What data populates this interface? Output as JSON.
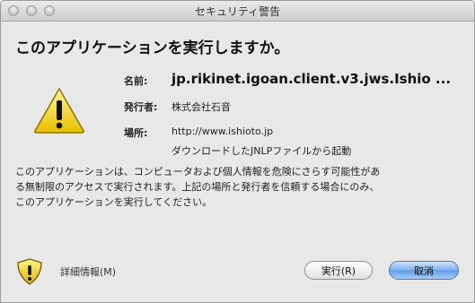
{
  "window": {
    "title": "セキュリティ警告"
  },
  "dialog": {
    "headline": "このアプリケーションを実行しますか。",
    "fields": {
      "name_label": "名前:",
      "name_value": "jp.rikinet.igoan.client.v3.jws.Ishio ...",
      "publisher_label": "発行者:",
      "publisher_value": "株式会社石音",
      "location_label": "場所:",
      "location_url": "http://www.ishioto.jp",
      "location_sub": "ダウンロードしたJNLPファイルから起動"
    },
    "description_lines": [
      "このアプリケーションは、コンピュータおよび個人情報を危険にさらす可能性があ",
      "る無制限のアクセスで実行されます。上記の場所と発行者を信頼する場合にのみ、",
      "このアプリケーションを実行してください。"
    ],
    "more_info": "詳細情報(M)",
    "buttons": {
      "run": "実行(R)",
      "cancel": "取消"
    }
  },
  "icons": {
    "warning": "warning-triangle-icon",
    "shield": "shield-warning-icon"
  },
  "colors": {
    "warning_yellow": "#f2d21b",
    "cancel_blue": "#6fa6ea"
  }
}
